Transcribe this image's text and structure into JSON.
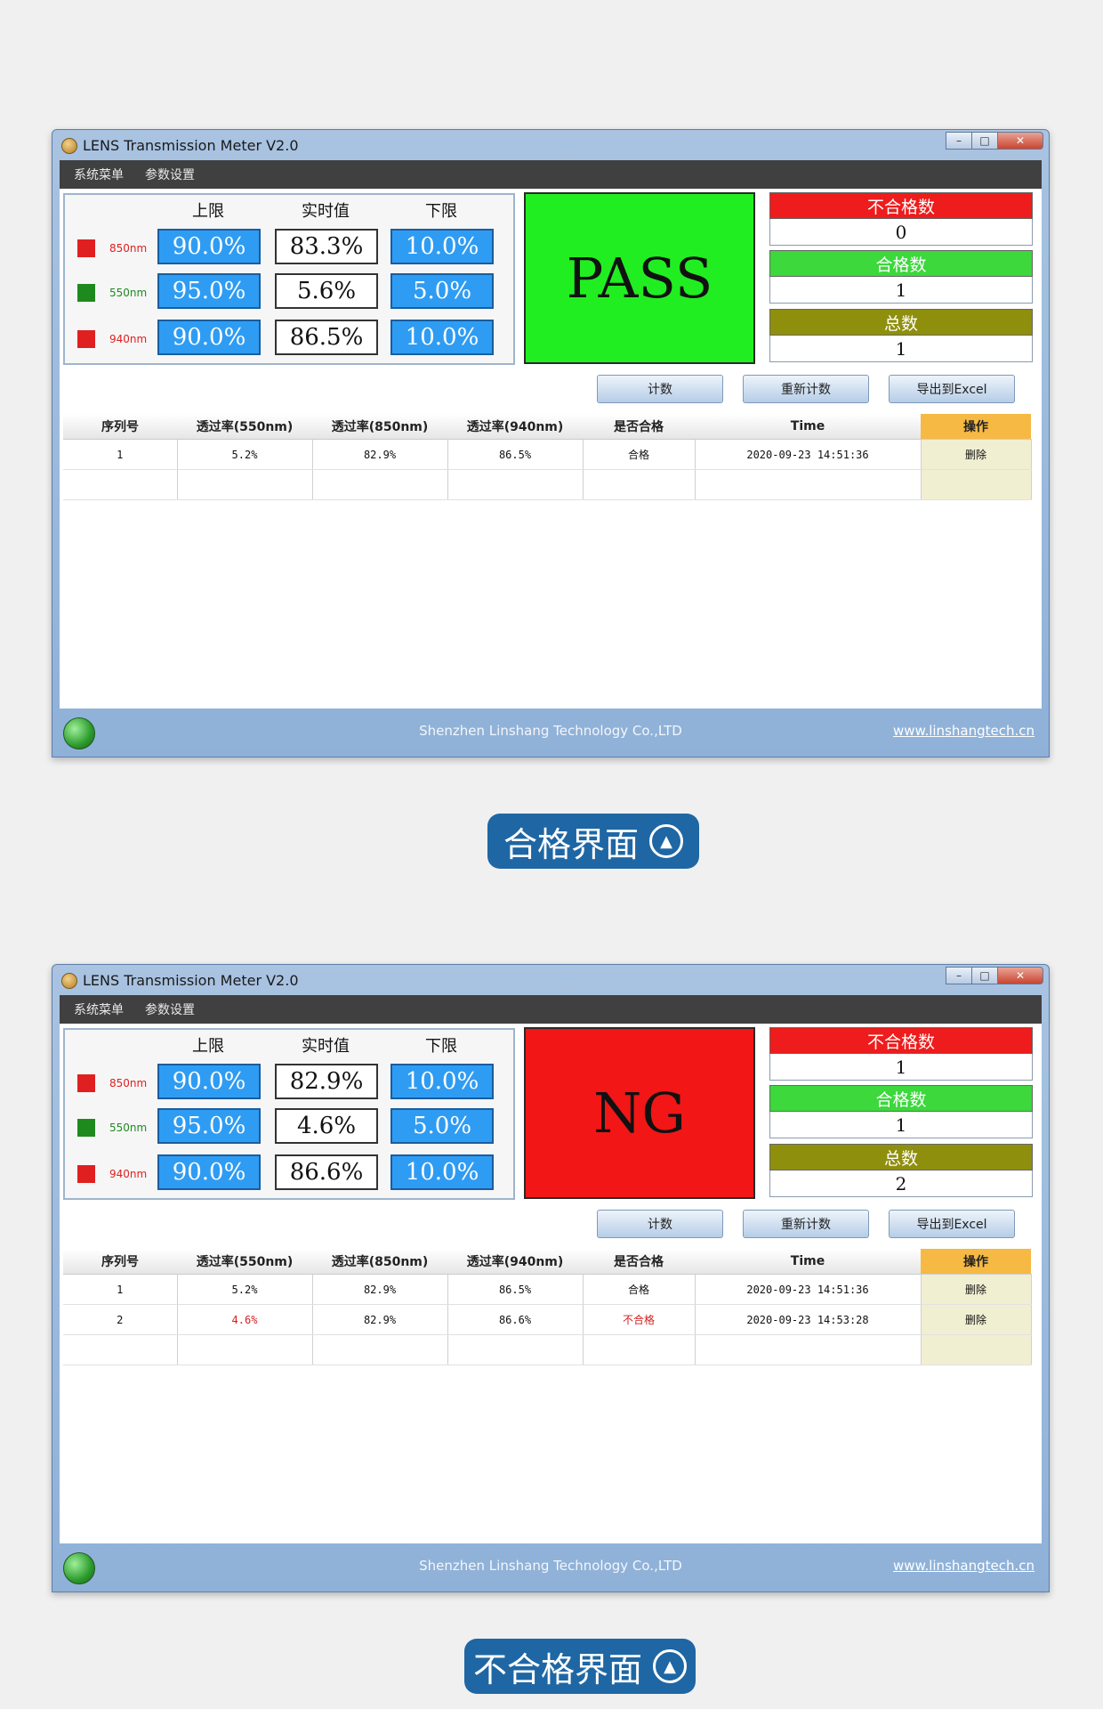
{
  "windows": [
    {
      "title": "LENS Transmission Meter V2.0",
      "menu": [
        "系统菜单",
        "参数设置"
      ],
      "column_headers": [
        "上限",
        "实时值",
        "下限"
      ],
      "rows": [
        {
          "label": "850nm",
          "color": "#e02020",
          "upper": "90.0%",
          "realtime": "83.3%",
          "lower": "10.0%"
        },
        {
          "label": "550nm",
          "color": "#1e8a1e",
          "upper": "95.0%",
          "realtime": "5.6%",
          "lower": "5.0%"
        },
        {
          "label": "940nm",
          "color": "#e02020",
          "upper": "90.0%",
          "realtime": "86.5%",
          "lower": "10.0%"
        }
      ],
      "status": {
        "text": "PASS",
        "color": "#21ee21"
      },
      "counters": [
        {
          "label": "不合格数",
          "value": "0",
          "color": "#ee1c1c"
        },
        {
          "label": "合格数",
          "value": "1",
          "color": "#3cd83c"
        },
        {
          "label": "总数",
          "value": "1",
          "color": "#8f8f0e"
        }
      ],
      "buttons": [
        "计数",
        "重新计数",
        "导出到Excel"
      ],
      "table_headers": [
        "序列号",
        "透过率(550nm)",
        "透过率(850nm)",
        "透过率(940nm)",
        "是否合格",
        "Time",
        "操作"
      ],
      "records": [
        {
          "no": "1",
          "t550": "5.2%",
          "t850": "82.9%",
          "t940": "86.5%",
          "result": "合格",
          "time": "2020-09-23 14:51:36",
          "op": "删除",
          "fail": false
        }
      ],
      "company": "Shenzhen Linshang Technology Co.,LTD",
      "website": "www.linshangtech.cn"
    },
    {
      "title": "LENS Transmission Meter V2.0",
      "menu": [
        "系统菜单",
        "参数设置"
      ],
      "column_headers": [
        "上限",
        "实时值",
        "下限"
      ],
      "rows": [
        {
          "label": "850nm",
          "color": "#e02020",
          "upper": "90.0%",
          "realtime": "82.9%",
          "lower": "10.0%"
        },
        {
          "label": "550nm",
          "color": "#1e8a1e",
          "upper": "95.0%",
          "realtime": "4.6%",
          "lower": "5.0%"
        },
        {
          "label": "940nm",
          "color": "#e02020",
          "upper": "90.0%",
          "realtime": "86.6%",
          "lower": "10.0%"
        }
      ],
      "status": {
        "text": "NG",
        "color": "#f21616"
      },
      "counters": [
        {
          "label": "不合格数",
          "value": "1",
          "color": "#ee1c1c"
        },
        {
          "label": "合格数",
          "value": "1",
          "color": "#3cd83c"
        },
        {
          "label": "总数",
          "value": "2",
          "color": "#8f8f0e"
        }
      ],
      "buttons": [
        "计数",
        "重新计数",
        "导出到Excel"
      ],
      "table_headers": [
        "序列号",
        "透过率(550nm)",
        "透过率(850nm)",
        "透过率(940nm)",
        "是否合格",
        "Time",
        "操作"
      ],
      "records": [
        {
          "no": "1",
          "t550": "5.2%",
          "t850": "82.9%",
          "t940": "86.5%",
          "result": "合格",
          "time": "2020-09-23 14:51:36",
          "op": "删除",
          "fail": false
        },
        {
          "no": "2",
          "t550": "4.6%",
          "t850": "82.9%",
          "t940": "86.6%",
          "result": "不合格",
          "time": "2020-09-23 14:53:28",
          "op": "删除",
          "fail": true
        }
      ],
      "company": "Shenzhen Linshang Technology Co.,LTD",
      "website": "www.linshangtech.cn"
    }
  ],
  "captions": [
    "合格界面",
    "不合格界面"
  ]
}
